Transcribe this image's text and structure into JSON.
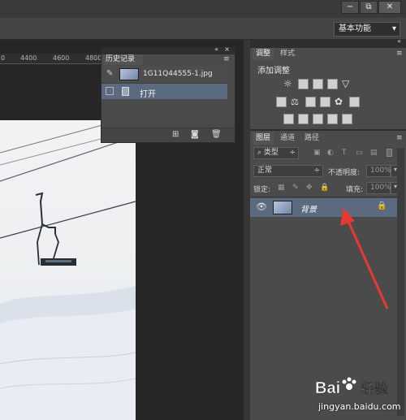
{
  "window": {
    "minimize_glyph": "−",
    "restore_glyph": "⧉",
    "close_glyph": "✕"
  },
  "workspace": {
    "label": "基本功能",
    "dropdown_glyph": "▾"
  },
  "ruler": {
    "ticks": [
      "0",
      "4400",
      "4600",
      "4800"
    ]
  },
  "history_panel": {
    "tab_label": "历史记录",
    "collapse_glyph": "«",
    "close_glyph": "×",
    "menu_glyph": "≡",
    "snapshot_label": "1G11Q44555-1.jpg",
    "items": [
      {
        "label": "打开"
      }
    ]
  },
  "adjustments_panel": {
    "tabs": [
      "调整",
      "样式"
    ],
    "title": "添加调整",
    "icon_names": [
      "brightness-icon",
      "levels-icon",
      "curves-icon",
      "exposure-icon",
      "vibrance-icon",
      "hue-saturation-icon",
      "color-balance-icon",
      "black-white-icon",
      "photo-filter-icon",
      "channel-mixer-icon",
      "color-lookup-icon",
      "invert-icon",
      "posterize-icon",
      "threshold-icon",
      "gradient-map-icon",
      "selective-color-icon"
    ]
  },
  "layers_panel": {
    "tabs": [
      "图层",
      "通道",
      "路径"
    ],
    "filter_label": "类型",
    "blend_mode": "正常",
    "opacity_label": "不透明度:",
    "opacity_value": "100%",
    "lock_label": "锁定:",
    "fill_label": "填充:",
    "fill_value": "100%",
    "layers": [
      {
        "name": "背景",
        "visible": true,
        "locked": true
      }
    ]
  },
  "watermark": {
    "logo_text": "Bai 经验",
    "url": "jingyan.baidu.com"
  },
  "colors": {
    "selection": "#5c6a80",
    "arrow": "#e8392f",
    "panel_bg": "#4b4b4b"
  }
}
